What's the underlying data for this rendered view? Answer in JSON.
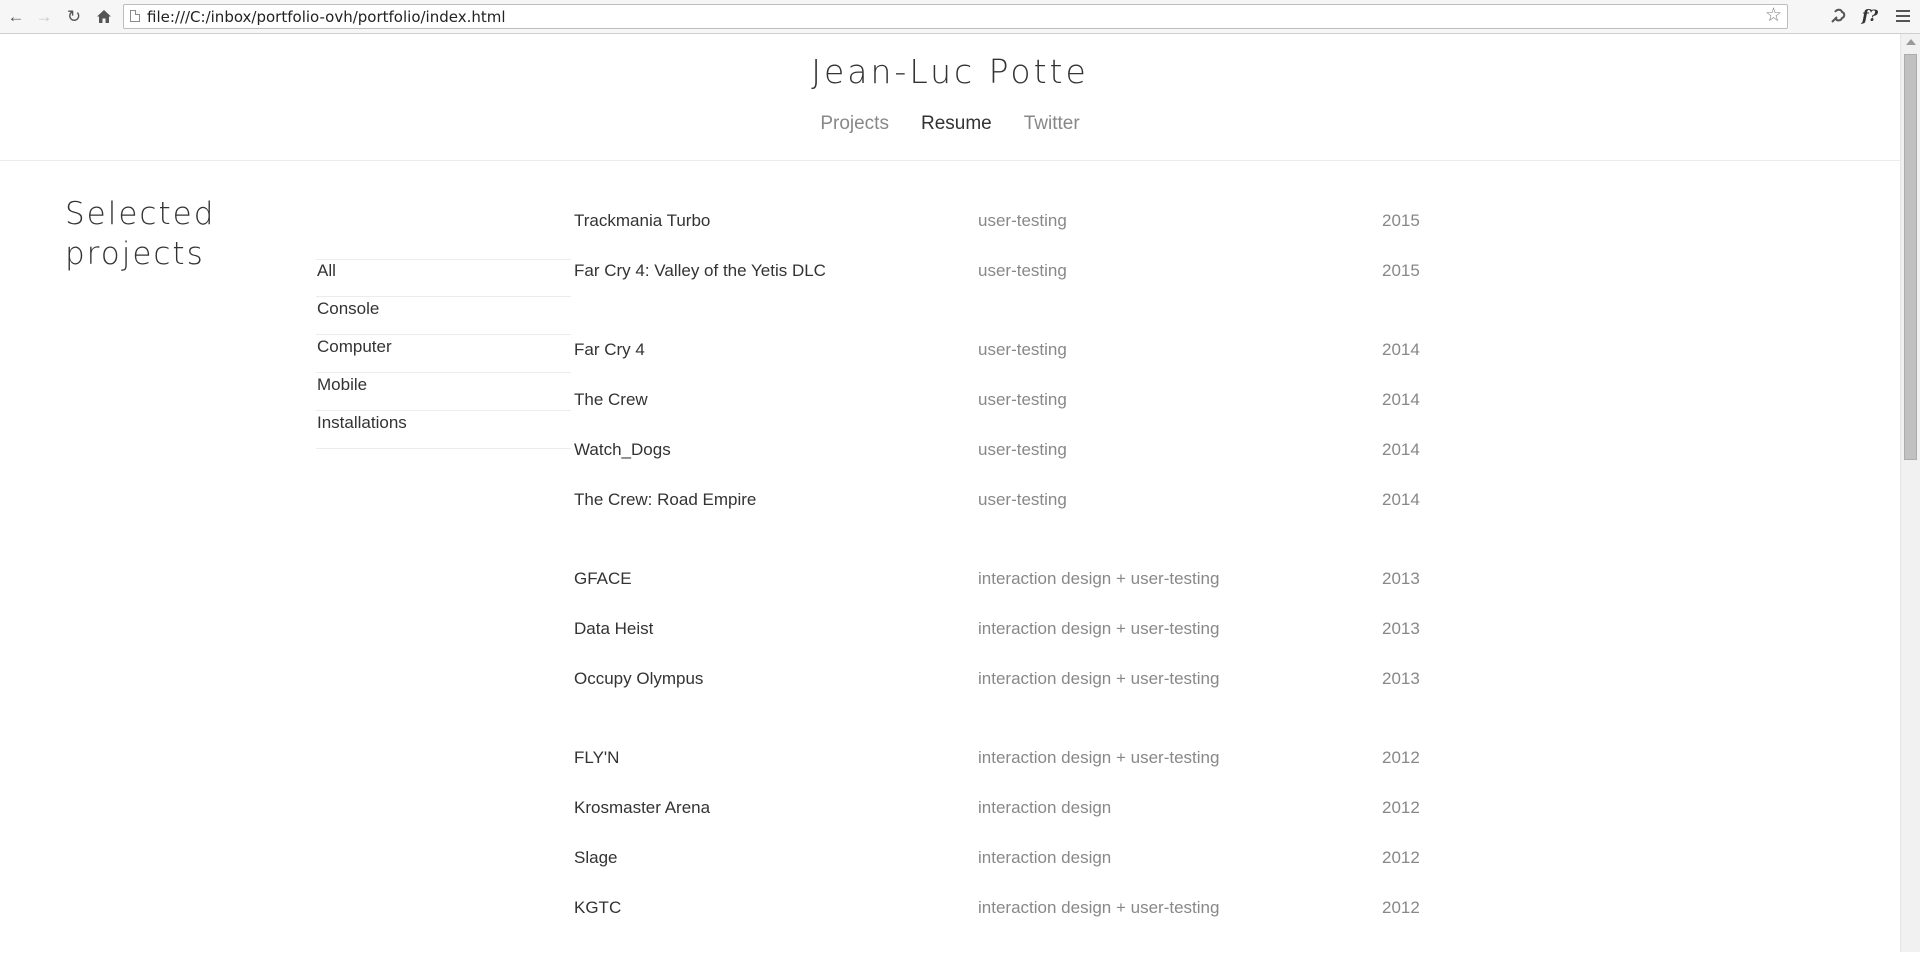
{
  "browser": {
    "url": "file:///C:/inbox/portfolio-ovh/portfolio/index.html",
    "icons": [
      "back-arrow-icon",
      "forward-arrow-icon",
      "reload-icon",
      "home-icon",
      "page-icon",
      "star-icon",
      "extension-icon",
      "font-finder-icon",
      "menu-icon"
    ]
  },
  "site": {
    "title": "Jean-Luc Potte",
    "nav": [
      {
        "label": "Projects",
        "active": false
      },
      {
        "label": "Resume",
        "active": true
      },
      {
        "label": "Twitter",
        "active": false
      }
    ]
  },
  "sidebar": {
    "heading_line1": "Selected",
    "heading_line2": "projects"
  },
  "filters": [
    "All",
    "Console",
    "Computer",
    "Mobile",
    "Installations"
  ],
  "projects": [
    [
      {
        "name": "Trackmania Turbo",
        "role": "user-testing",
        "year": "2015"
      },
      {
        "name": "Far Cry 4: Valley of the Yetis DLC",
        "role": "user-testing",
        "year": "2015"
      }
    ],
    [
      {
        "name": "Far Cry 4",
        "role": "user-testing",
        "year": "2014"
      },
      {
        "name": "The Crew",
        "role": "user-testing",
        "year": "2014"
      },
      {
        "name": "Watch_Dogs",
        "role": "user-testing",
        "year": "2014"
      },
      {
        "name": "The Crew: Road Empire",
        "role": "user-testing",
        "year": "2014"
      }
    ],
    [
      {
        "name": "GFACE",
        "role": "interaction design + user-testing",
        "year": "2013"
      },
      {
        "name": "Data Heist",
        "role": "interaction design + user-testing",
        "year": "2013"
      },
      {
        "name": "Occupy Olympus",
        "role": "interaction design + user-testing",
        "year": "2013"
      }
    ],
    [
      {
        "name": "FLY'N",
        "role": "interaction design + user-testing",
        "year": "2012"
      },
      {
        "name": "Krosmaster Arena",
        "role": "interaction design",
        "year": "2012"
      },
      {
        "name": "Slage",
        "role": "interaction design",
        "year": "2012"
      },
      {
        "name": "KGTC",
        "role": "interaction design + user-testing",
        "year": "2012"
      }
    ]
  ]
}
